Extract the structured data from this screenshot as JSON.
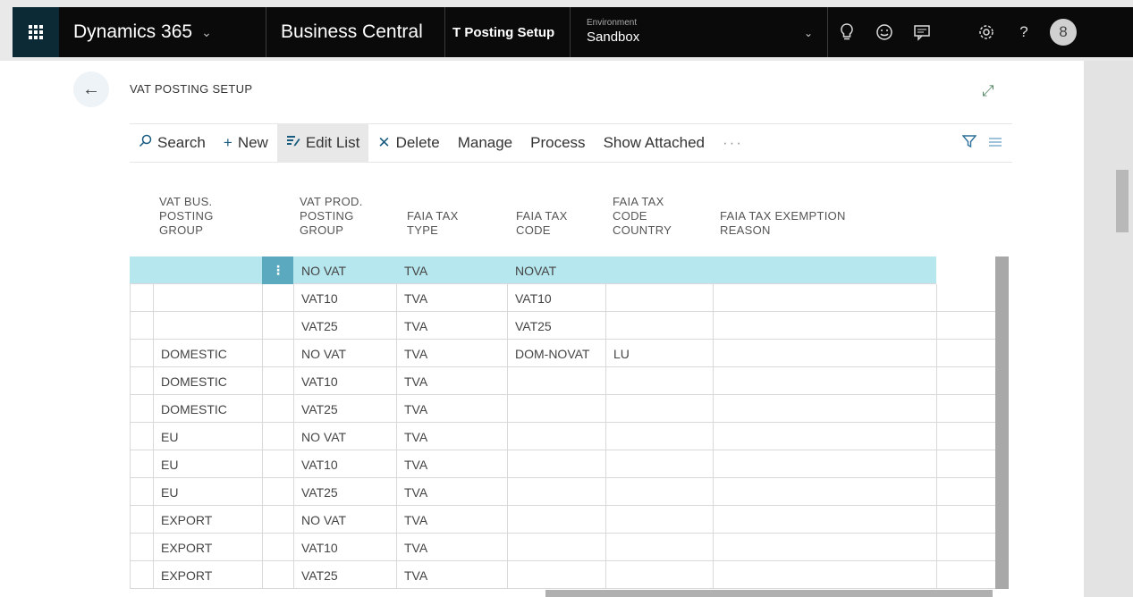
{
  "topnav": {
    "app_launcher_icon": "waffle-icon",
    "product": "Dynamics 365",
    "app": "Business Central",
    "page_tab": "T Posting Setup",
    "environment_label": "Environment",
    "environment_value": "Sandbox",
    "icons": [
      "lightbulb-icon",
      "smiley-icon",
      "feedback-icon",
      "settings-icon",
      "help-icon"
    ],
    "help_glyph": "?",
    "avatar_initial": "8"
  },
  "page": {
    "title": "VAT POSTING SETUP",
    "back_icon": "arrow-left-icon",
    "expand_icon": "expand-icon"
  },
  "actions": {
    "search": "Search",
    "new": "New",
    "edit_list": "Edit List",
    "delete": "Delete",
    "manage": "Manage",
    "process": "Process",
    "show_attached": "Show Attached",
    "more": "···"
  },
  "table": {
    "headers": {
      "vat_bus": [
        "VAT BUS.",
        "POSTING",
        "GROUP"
      ],
      "vat_prod": [
        "VAT PROD.",
        "POSTING",
        "GROUP"
      ],
      "faia_tax_type": [
        "FAIA TAX",
        "TYPE"
      ],
      "faia_tax_code": [
        "FAIA TAX",
        "CODE"
      ],
      "faia_tax_code_country": [
        "FAIA TAX",
        "CODE",
        "COUNTRY"
      ],
      "faia_tax_exemption_reason": [
        "FAIA TAX EXEMPTION",
        "REASON"
      ]
    },
    "rows": [
      {
        "bus": "",
        "prod": "NO VAT",
        "type": "TVA",
        "code": "NOVAT",
        "country": "",
        "reason": ""
      },
      {
        "bus": "",
        "prod": "VAT10",
        "type": "TVA",
        "code": "VAT10",
        "country": "",
        "reason": ""
      },
      {
        "bus": "",
        "prod": "VAT25",
        "type": "TVA",
        "code": "VAT25",
        "country": "",
        "reason": ""
      },
      {
        "bus": "DOMESTIC",
        "prod": "NO VAT",
        "type": "TVA",
        "code": "DOM-NOVAT",
        "country": "LU",
        "reason": ""
      },
      {
        "bus": "DOMESTIC",
        "prod": "VAT10",
        "type": "TVA",
        "code": "",
        "country": "",
        "reason": ""
      },
      {
        "bus": "DOMESTIC",
        "prod": "VAT25",
        "type": "TVA",
        "code": "",
        "country": "",
        "reason": ""
      },
      {
        "bus": "EU",
        "prod": "NO VAT",
        "type": "TVA",
        "code": "",
        "country": "",
        "reason": ""
      },
      {
        "bus": "EU",
        "prod": "VAT10",
        "type": "TVA",
        "code": "",
        "country": "",
        "reason": ""
      },
      {
        "bus": "EU",
        "prod": "VAT25",
        "type": "TVA",
        "code": "",
        "country": "",
        "reason": ""
      },
      {
        "bus": "EXPORT",
        "prod": "NO VAT",
        "type": "TVA",
        "code": "",
        "country": "",
        "reason": ""
      },
      {
        "bus": "EXPORT",
        "prod": "VAT10",
        "type": "TVA",
        "code": "",
        "country": "",
        "reason": ""
      },
      {
        "bus": "EXPORT",
        "prod": "VAT25",
        "type": "TVA",
        "code": "",
        "country": "",
        "reason": ""
      }
    ],
    "selected_row_index": 0,
    "row_menu_glyph": "⋮"
  },
  "colors": {
    "selected_row": "#b6e6ee",
    "row_menu": "#5aa9bf",
    "accent": "#1a5c80",
    "navbar": "#0a0a0a"
  }
}
